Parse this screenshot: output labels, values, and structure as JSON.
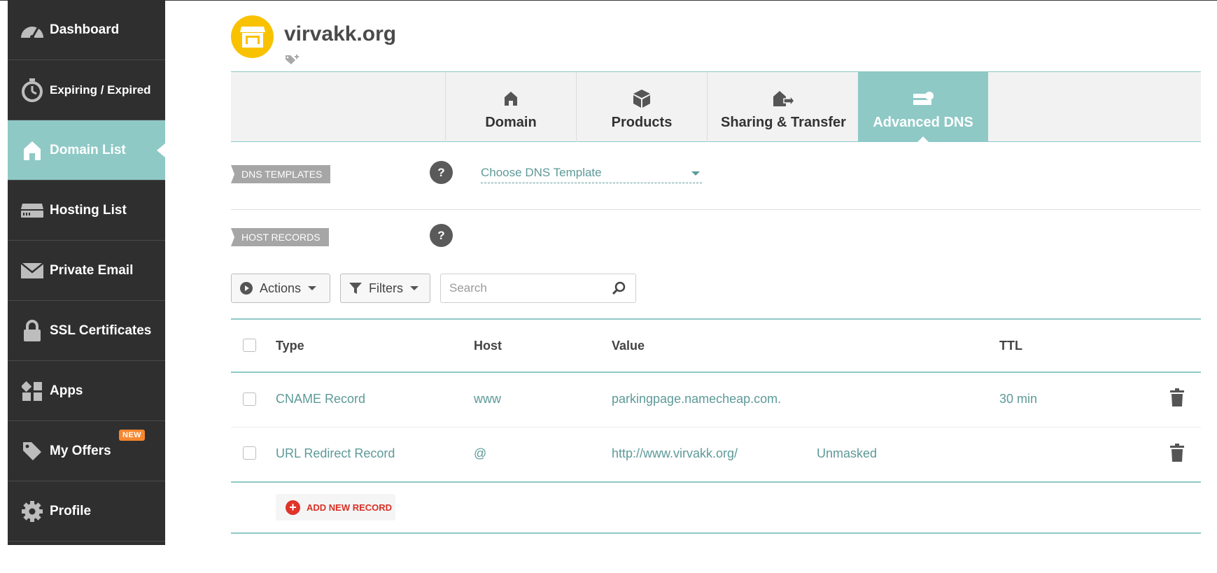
{
  "sidebar": {
    "items": [
      {
        "label": "Dashboard",
        "icon": "speedometer-icon"
      },
      {
        "label": "Expiring / Expired",
        "icon": "stopwatch-icon"
      },
      {
        "label": "Domain List",
        "icon": "home-icon",
        "active": true
      },
      {
        "label": "Hosting List",
        "icon": "server-icon"
      },
      {
        "label": "Private Email",
        "icon": "envelope-icon"
      },
      {
        "label": "SSL Certificates",
        "icon": "lock-icon"
      },
      {
        "label": "Apps",
        "icon": "apps-grid-icon"
      },
      {
        "label": "My Offers",
        "icon": "tag-icon",
        "badge": "NEW"
      },
      {
        "label": "Profile",
        "icon": "gear-icon"
      }
    ]
  },
  "header": {
    "domain": "virvakk.org",
    "logo_icon": "storefront-icon"
  },
  "tabs": [
    {
      "label": "Domain",
      "icon": "home-icon"
    },
    {
      "label": "Products",
      "icon": "box-icon"
    },
    {
      "label": "Sharing & Transfer",
      "icon": "transfer-icon"
    },
    {
      "label": "Advanced DNS",
      "icon": "dns-server-icon",
      "active": true
    }
  ],
  "dns_templates": {
    "label": "DNS TEMPLATES",
    "help": "?",
    "select_value": "Choose DNS Template"
  },
  "host_records": {
    "label": "HOST RECORDS",
    "help": "?"
  },
  "toolbar": {
    "actions_label": "Actions",
    "filters_label": "Filters",
    "search_placeholder": "Search"
  },
  "table": {
    "headers": {
      "type": "Type",
      "host": "Host",
      "value": "Value",
      "ttl": "TTL"
    },
    "rows": [
      {
        "type": "CNAME Record",
        "host": "www",
        "value": "parkingpage.namecheap.com.",
        "extra": "",
        "ttl": "30 min"
      },
      {
        "type": "URL Redirect Record",
        "host": "@",
        "value": "http://www.virvakk.org/",
        "extra": "Unmasked",
        "ttl": ""
      }
    ]
  },
  "add_record": {
    "label": "ADD NEW RECORD"
  },
  "colors": {
    "sidebar_bg": "#2f2f2f",
    "accent_teal": "#8ec9c6",
    "link_teal": "#5d9a98",
    "logo_yellow": "#f9c200",
    "badge_orange": "#f7872f",
    "add_red": "#e0332a"
  }
}
